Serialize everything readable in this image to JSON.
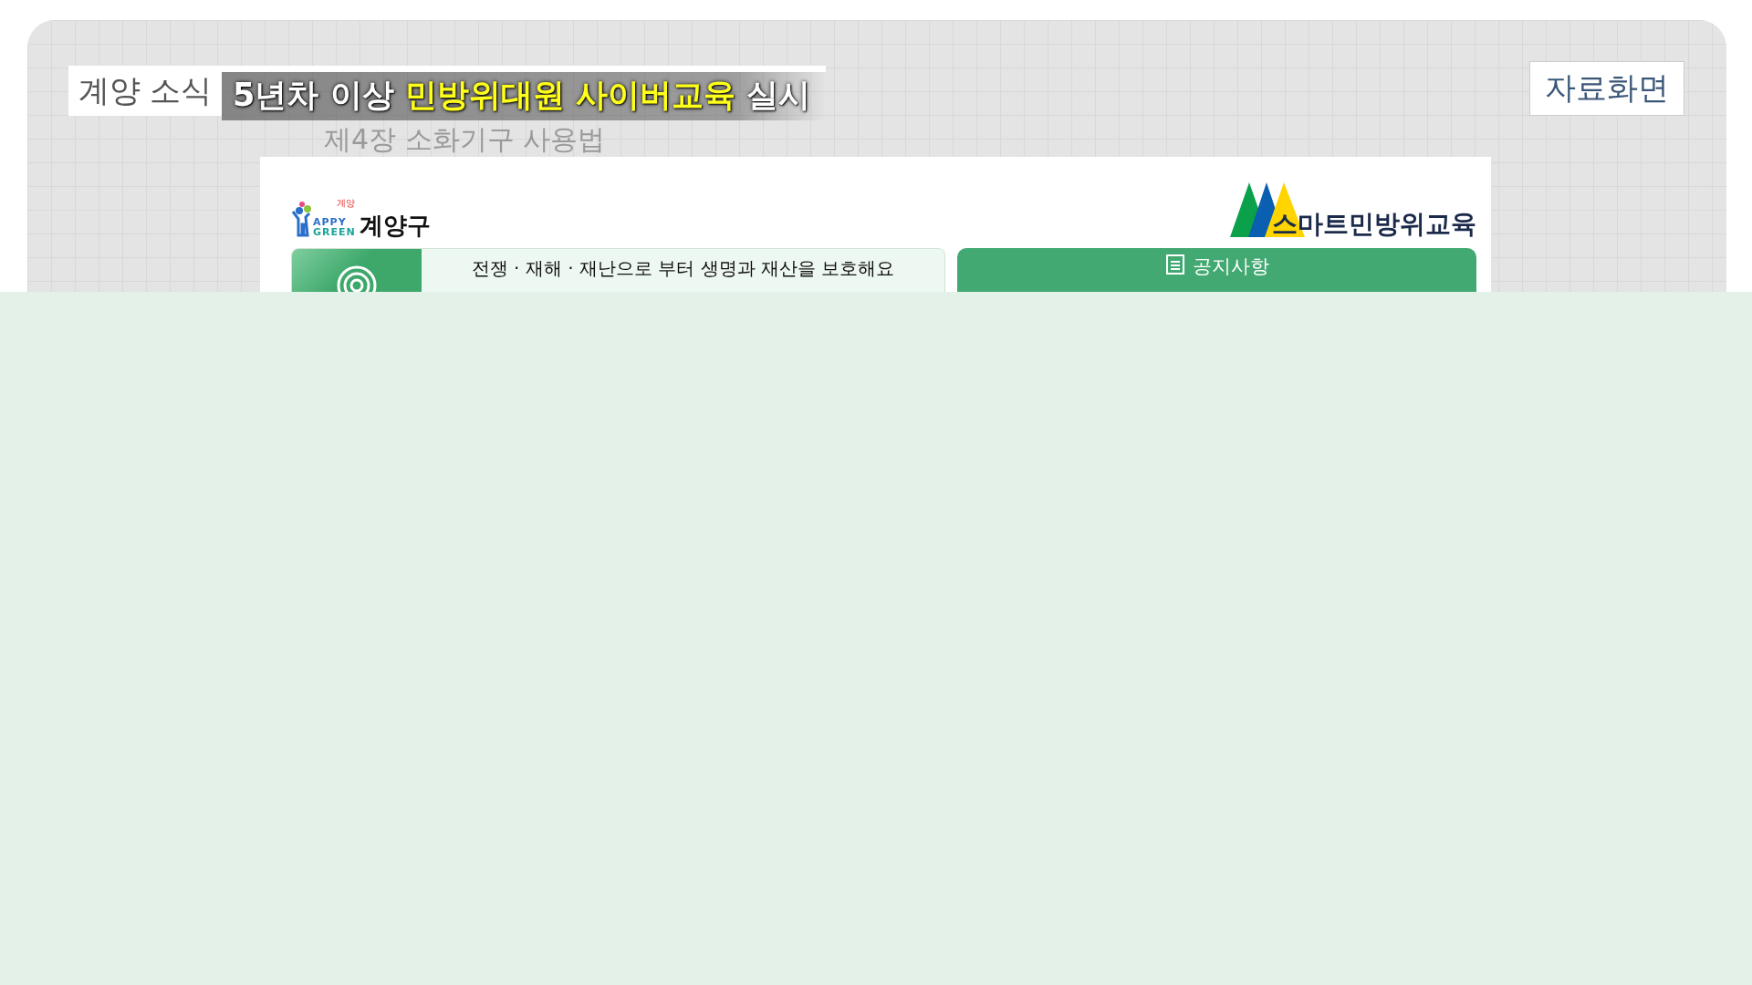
{
  "broadcast": {
    "section_label": "계양 소식",
    "headline": [
      {
        "text": "5년차 이상",
        "highlight": false
      },
      {
        "text": "민방위대원 사이버교육",
        "highlight": true
      },
      {
        "text": "실시",
        "highlight": false
      }
    ],
    "badge": "자료화면",
    "background_subtitle": "제4장 소화기구 사용법"
  },
  "website": {
    "district_logo": {
      "tag": "계양",
      "wordmark_top": "APPY",
      "wordmark_bottom": "GREEN",
      "name": "계양구"
    },
    "education_logo": "스마트민방위교육",
    "banner": {
      "text": "전쟁 · 재해 · 재난으로 부터 생명과 재산을 보호해요"
    },
    "notice_button": {
      "label": "공지사항"
    }
  }
}
